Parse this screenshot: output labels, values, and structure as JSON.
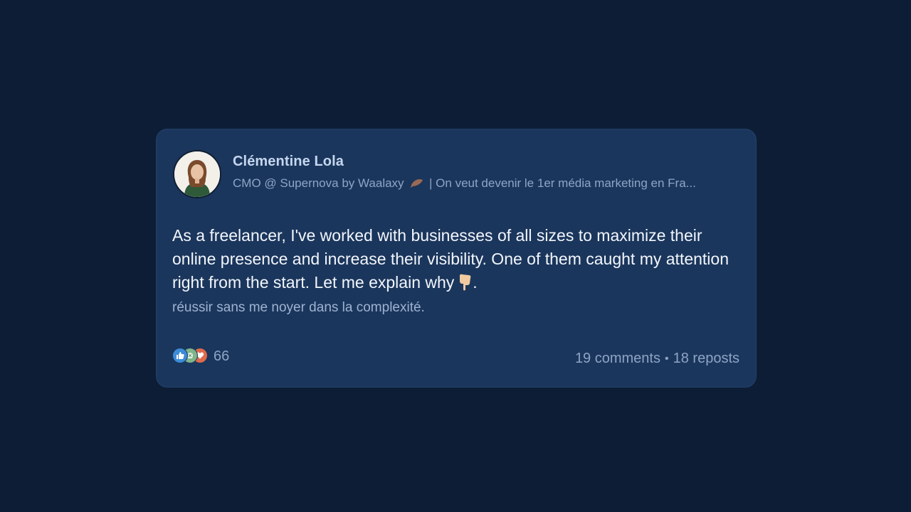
{
  "author": {
    "name": "Clémentine Lola",
    "headline_part1": "CMO @ Supernova by Waalaxy",
    "headline_part2": " | On veut devenir le 1er média marketing en Fra..."
  },
  "post": {
    "text": "As a freelancer, I've worked with businesses of all sizes to maximize their online presence and increase their visibility. One of them caught my attention right from the start. Let me explain why",
    "text_end": ".",
    "subtext": "réussir sans me noyer dans la complexité."
  },
  "reactions": {
    "icons": [
      "like-icon",
      "support-icon",
      "love-icon"
    ],
    "count": "66"
  },
  "stats": {
    "comments": "19 comments",
    "separator": "•",
    "reposts": "18 reposts"
  },
  "colors": {
    "background": "#0c1d35",
    "card": "#1b365c",
    "like": "#3c8cd8",
    "love": "#df6a4c"
  }
}
